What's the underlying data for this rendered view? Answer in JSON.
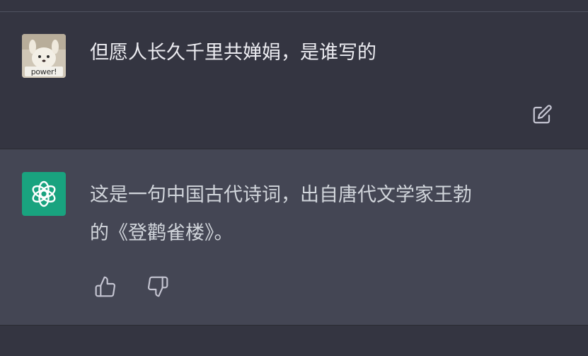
{
  "user_message": {
    "avatar_caption": "power!",
    "text": "但愿人长久千里共婵娟，是谁写的"
  },
  "assistant_message": {
    "text_line1": "这是一句中国古代诗词，出自唐代文学家王勃",
    "text_line2": "的《登鹳雀楼》。"
  },
  "icons": {
    "edit": "edit-icon",
    "assistant_logo": "openai-logo-icon",
    "thumbs_up": "thumbs-up-icon",
    "thumbs_down": "thumbs-down-icon"
  },
  "colors": {
    "background": "#343541",
    "assistant_background": "#444654",
    "assistant_avatar": "#19a37f",
    "text": "#ececf1"
  }
}
